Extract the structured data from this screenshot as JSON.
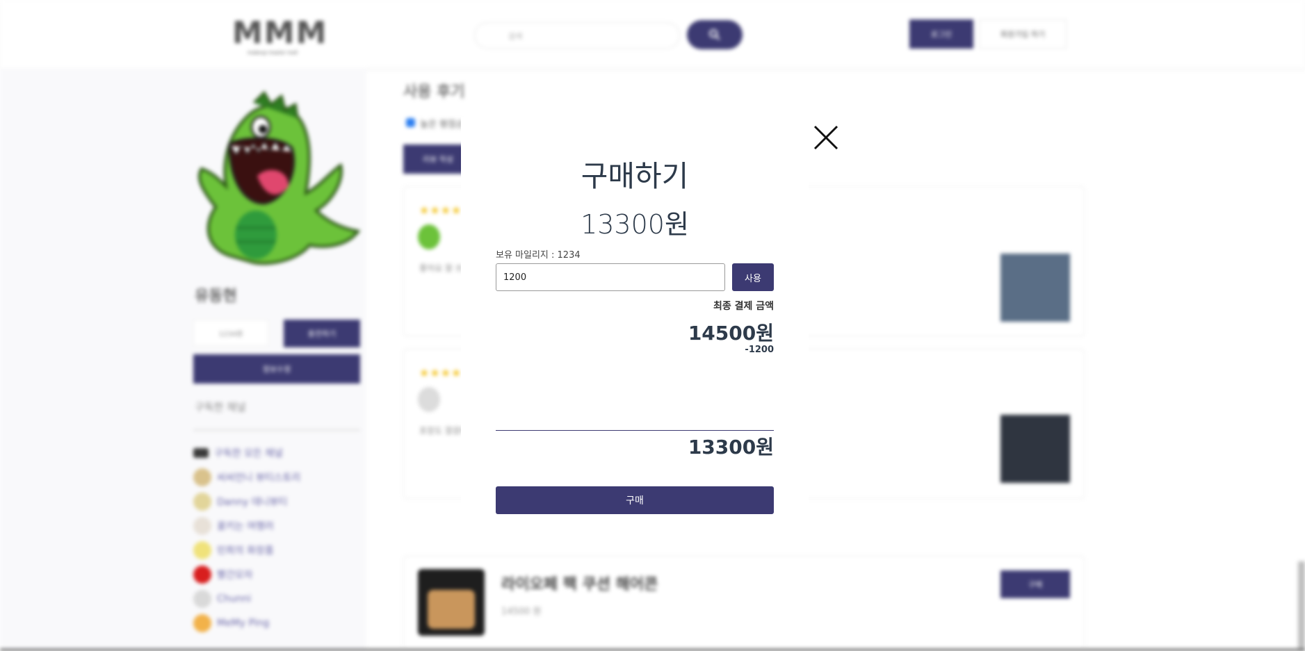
{
  "header": {
    "logo_text": "MMM",
    "logo_subtitle": "makeup master mall",
    "search_placeholder": "검색",
    "login_label": "로그인",
    "signup_label": "회원가입 하기"
  },
  "sidebar": {
    "user_name": "유동현",
    "mileage_value": "1234원",
    "charge_label": "충전하기",
    "edit_label": "정보수정",
    "subscriptions_title": "구독한 채널",
    "channels": [
      {
        "label": "구독한 모든 채널",
        "color": "#3b3b3b"
      },
      {
        "label": "씨씨언니 뷰티스토리",
        "color": "#d9c28c"
      },
      {
        "label": "Danny 데니뷰티",
        "color": "#e2d59a"
      },
      {
        "label": "꿀키는 여행러",
        "color": "#e8e1d8"
      },
      {
        "label": "민희의 화장품",
        "color": "#f0e27a"
      },
      {
        "label": "빨간모자",
        "color": "#d81e1e"
      },
      {
        "label": "Chunni",
        "color": "#d9d9d9"
      },
      {
        "label": "MeMy Ping",
        "color": "#f2b24a"
      }
    ]
  },
  "main": {
    "section_title": "사용 후기",
    "filter_label": "높은 평점순",
    "write_review_label": "리뷰 작성",
    "reviews": [
      {
        "stars": "★★★★★",
        "text": "좋아요 잘 쓰고 있어요"
      },
      {
        "stars": "★★★★★",
        "text": "포장도 깔끔하고 배송 빨라요"
      }
    ],
    "product": {
      "name": "라이오페 팩 쿠션 해어콘",
      "price": "14500 원",
      "buy_label": "구매"
    }
  },
  "modal": {
    "title": "구매하기",
    "price": "13300원",
    "mileage_label": "보유 마일리지 : 1234",
    "mileage_input_value": "1200",
    "use_label": "사용",
    "final_label": "최종 결제 금액",
    "subtotal": "14500원",
    "discount": "-1200",
    "total": "13300원",
    "purchase_label": "구매"
  },
  "colors": {
    "accent": "#3c3a72",
    "star": "#f3c21a"
  }
}
